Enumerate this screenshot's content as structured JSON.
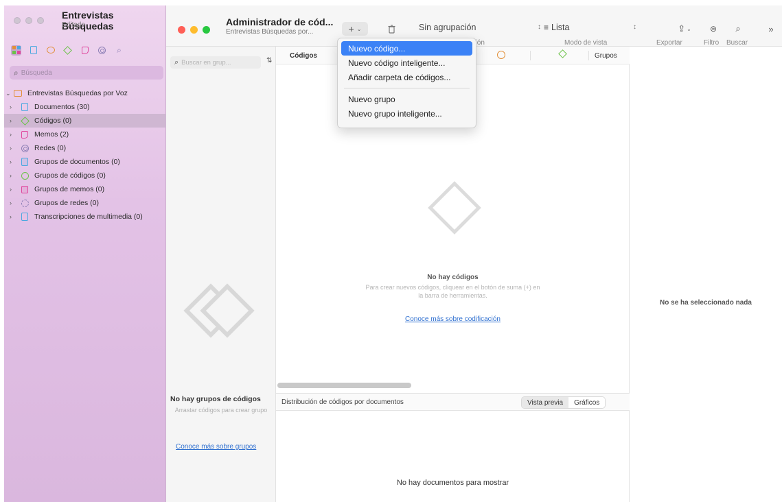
{
  "left_window": {
    "title": "Entrevistas Búsquedas",
    "subtitle": "Editado",
    "search_placeholder": "Búsqueda",
    "tree": {
      "root_label": "Entrevistas Búsquedas por Voz",
      "items": [
        {
          "label": "Documentos (30)",
          "icon": "document-icon"
        },
        {
          "label": "Códigos (0)",
          "icon": "code-icon"
        },
        {
          "label": "Memos (2)",
          "icon": "memo-icon"
        },
        {
          "label": "Redes (0)",
          "icon": "network-icon"
        },
        {
          "label": "Grupos de documentos (0)",
          "icon": "document-group-icon"
        },
        {
          "label": "Grupos de códigos (0)",
          "icon": "code-group-icon"
        },
        {
          "label": "Grupos de memos (0)",
          "icon": "memo-group-icon"
        },
        {
          "label": "Grupos de redes (0)",
          "icon": "network-group-icon"
        },
        {
          "label": "Transcripciones de multimedia (0)",
          "icon": "media-transcription-icon"
        }
      ]
    }
  },
  "main_window": {
    "title": "Administrador de cód...",
    "subtitle": "Entrevistas Búsquedas por...",
    "toolbar": {
      "grouping_value": "Sin agrupación",
      "grouping_label_partial": "ación",
      "view_mode_value": "Lista",
      "view_mode_label": "Modo de vista",
      "export_label": "Exportar",
      "filter_label": "Filtro",
      "search_label": "Buscar"
    }
  },
  "groups_pane": {
    "search_placeholder": "Buscar en grup...",
    "empty_title": "No hay grupos de códigos",
    "empty_desc": "Arrastar códigos para crear grupo",
    "link": "Conoce más sobre grupos"
  },
  "codes_pane": {
    "header_codes": "Códigos",
    "header_groups": "Grupos",
    "empty_title": "No hay códigos",
    "empty_desc": "Para crear nuevos códigos, cliquear en el botón de suma (+) en la barra de herramientas.",
    "link": "Conoce más sobre codificación",
    "distribution_title": "Distribución de códigos por documentos",
    "tab_preview": "Vista previa",
    "tab_charts": "Gráficos",
    "no_documents": "No hay documentos para mostrar"
  },
  "inspector": {
    "message": "No se ha seleccionado nada"
  },
  "add_menu": {
    "items": [
      "Nuevo código...",
      "Nuevo código inteligente...",
      "Añadir carpeta de códigos...",
      "Nuevo grupo",
      "Nuevo grupo inteligente..."
    ]
  },
  "colors": {
    "accent": "#3b82f6",
    "sidebar_bg": "#e3c2e6",
    "link": "#2e6fd0"
  }
}
